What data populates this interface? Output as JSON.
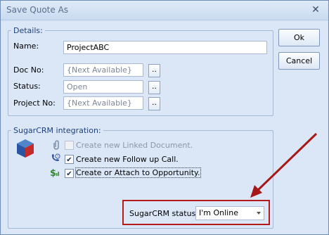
{
  "window": {
    "title": "Save Quote As"
  },
  "buttons": {
    "ok": "Ok",
    "cancel": "Cancel",
    "browse": ".."
  },
  "details": {
    "legend": "Details:",
    "name_label": "Name:",
    "name_value": "ProjectABC",
    "doc_no_label": "Doc No:",
    "doc_no_value": "{Next Available}",
    "status_label": "Status:",
    "status_value": "Open",
    "project_no_label": "Project No:",
    "project_no_value": "{Next Available}"
  },
  "sugarcrm": {
    "legend": "SugarCRM integration:",
    "options": [
      {
        "label": "Create new Linked Document.",
        "checked": false,
        "enabled": false,
        "icon": "paperclip-icon"
      },
      {
        "label": "Create new Follow up Call.",
        "checked": true,
        "enabled": true,
        "icon": "phone-clock-icon"
      },
      {
        "label": "Create or Attach to Opportunity.",
        "checked": true,
        "enabled": true,
        "icon": "dollar-icon"
      }
    ],
    "status_label": "SugarCRM status:",
    "status_value": "I'm Online"
  },
  "colors": {
    "highlight_box": "#b31b1b",
    "annotation_arrow": "#a51818"
  }
}
